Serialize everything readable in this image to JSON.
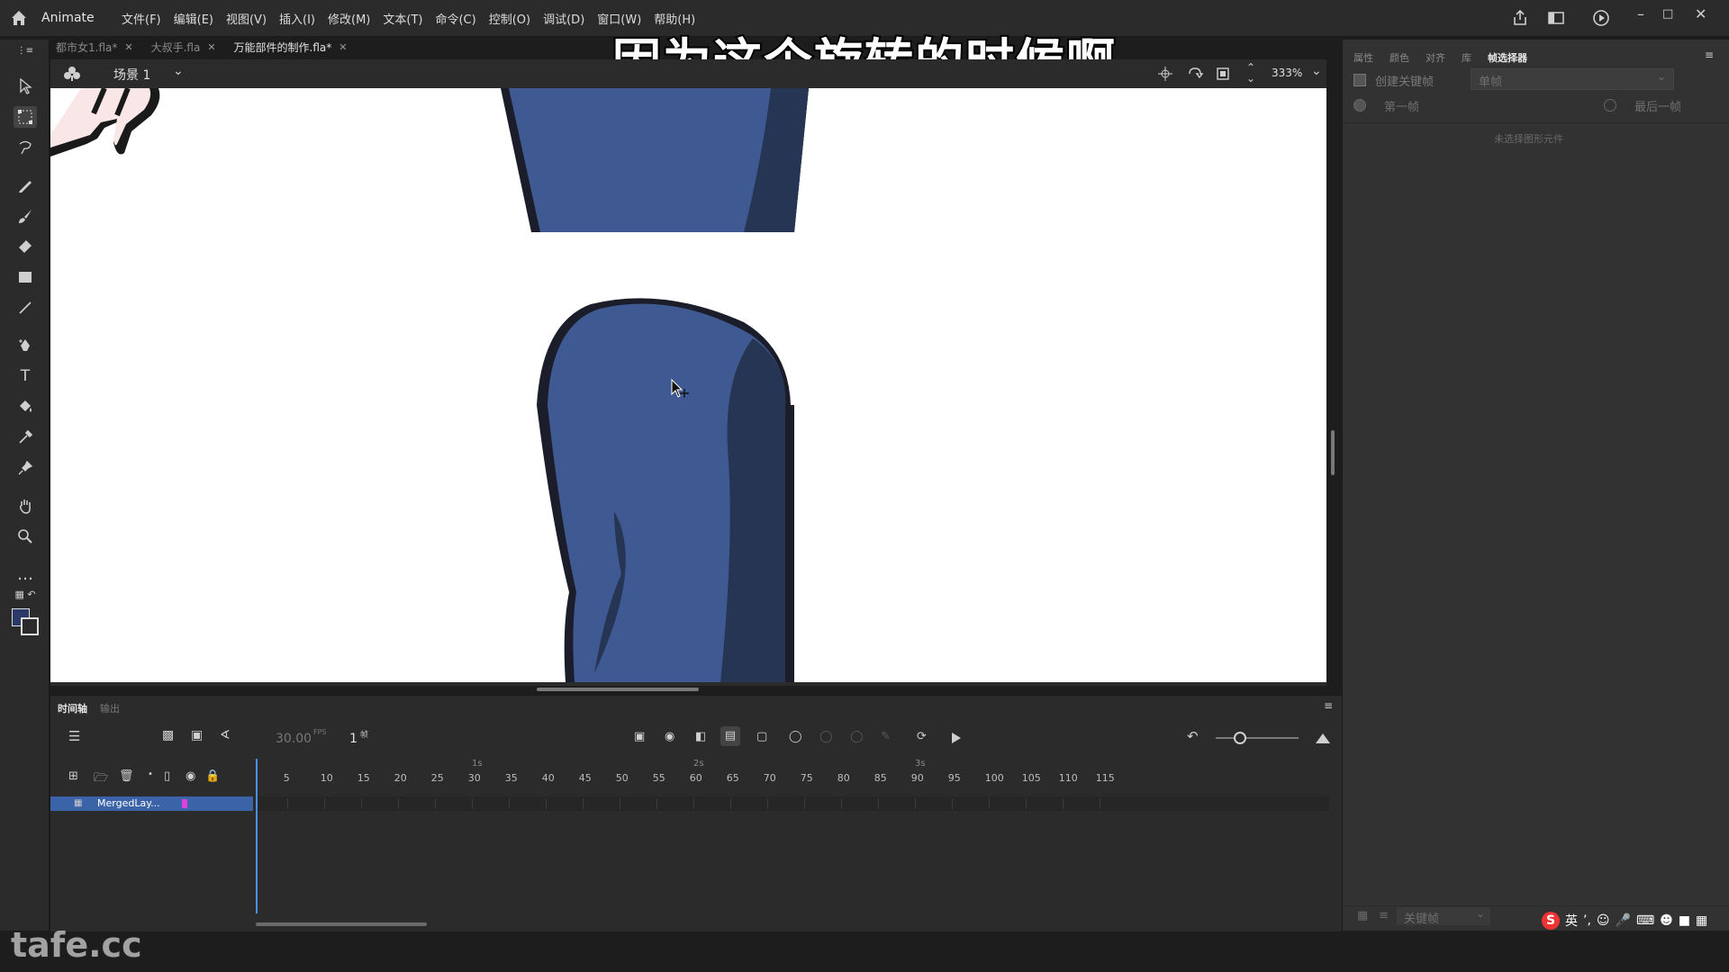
{
  "app": {
    "name": "Animate"
  },
  "menu": [
    "文件(F)",
    "编辑(E)",
    "视图(V)",
    "插入(I)",
    "修改(M)",
    "文本(T)",
    "命令(C)",
    "控制(O)",
    "调试(D)",
    "窗口(W)",
    "帮助(H)"
  ],
  "documents": [
    {
      "name": "都市女1.fla*",
      "active": false
    },
    {
      "name": "大叔手.fla",
      "active": false
    },
    {
      "name": "万能部件的制作.fla*",
      "active": true
    }
  ],
  "scene": {
    "label": "场景 1",
    "zoom": "333%"
  },
  "subtitle": "因为这个旋转的时候啊",
  "right_panel": {
    "tabs": [
      "属性",
      "颜色",
      "对齐",
      "库",
      "帧选择器"
    ],
    "active_tab": "帧选择器",
    "create_keyframe_label": "创建关键帧",
    "mode_value": "单帧",
    "first_frame_label": "第一帧",
    "last_frame_label": "最后一帧",
    "empty_message": "未选择图形元件",
    "bottom_select": "关键帧"
  },
  "timeline": {
    "tabs": [
      "时间轴",
      "输出"
    ],
    "fps": "30.00",
    "fps_unit": "FPS",
    "current_frame": "1",
    "frame_unit": "帧",
    "ruler_ticks": [
      "5",
      "10",
      "15",
      "20",
      "25",
      "30",
      "35",
      "40",
      "45",
      "50",
      "55",
      "60",
      "65",
      "70",
      "75",
      "80",
      "85",
      "90",
      "95",
      "100",
      "105",
      "110",
      "115"
    ],
    "seconds": [
      "1s",
      "2s",
      "3s"
    ],
    "layers": [
      {
        "name": "MergedLay...",
        "color": "#e040e0"
      }
    ]
  },
  "watermark": "tafe.cc",
  "ime": {
    "lang": "英"
  },
  "colors": {
    "stroke": "#1b1d2a",
    "fill": "#3f5a92",
    "shadow": "#263554",
    "accent": "#3a63a8"
  }
}
